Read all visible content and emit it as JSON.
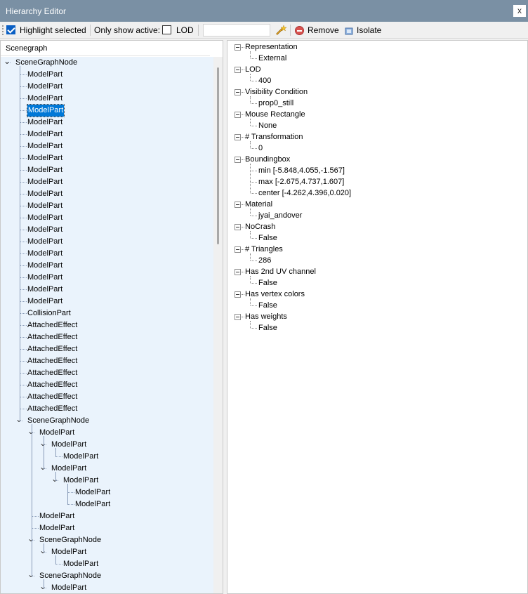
{
  "window": {
    "title": "Hierarchy Editor",
    "close_glyph": "x"
  },
  "toolbar": {
    "highlight_selected": {
      "label": "Highlight selected",
      "checked": true
    },
    "only_show_active_label": "Only show active:",
    "lod": {
      "label": "LOD",
      "checked": false
    },
    "search_value": "",
    "remove_label": "Remove",
    "isolate_label": "Isolate",
    "icons": [
      "wand-icon",
      "remove-icon",
      "isolate-icon"
    ]
  },
  "scenegraph": {
    "header": "Scenegraph",
    "nodes": [
      {
        "label": "SceneGraphNode",
        "depth": 0,
        "expanded": true
      },
      {
        "label": "ModelPart",
        "depth": 1
      },
      {
        "label": "ModelPart",
        "depth": 1
      },
      {
        "label": "ModelPart",
        "depth": 1
      },
      {
        "label": "ModelPart",
        "depth": 1,
        "selected": true
      },
      {
        "label": "ModelPart",
        "depth": 1
      },
      {
        "label": "ModelPart",
        "depth": 1
      },
      {
        "label": "ModelPart",
        "depth": 1
      },
      {
        "label": "ModelPart",
        "depth": 1
      },
      {
        "label": "ModelPart",
        "depth": 1
      },
      {
        "label": "ModelPart",
        "depth": 1
      },
      {
        "label": "ModelPart",
        "depth": 1
      },
      {
        "label": "ModelPart",
        "depth": 1
      },
      {
        "label": "ModelPart",
        "depth": 1
      },
      {
        "label": "ModelPart",
        "depth": 1
      },
      {
        "label": "ModelPart",
        "depth": 1
      },
      {
        "label": "ModelPart",
        "depth": 1
      },
      {
        "label": "ModelPart",
        "depth": 1
      },
      {
        "label": "ModelPart",
        "depth": 1
      },
      {
        "label": "ModelPart",
        "depth": 1
      },
      {
        "label": "ModelPart",
        "depth": 1
      },
      {
        "label": "CollisionPart",
        "depth": 1
      },
      {
        "label": "AttachedEffect",
        "depth": 1
      },
      {
        "label": "AttachedEffect",
        "depth": 1
      },
      {
        "label": "AttachedEffect",
        "depth": 1
      },
      {
        "label": "AttachedEffect",
        "depth": 1
      },
      {
        "label": "AttachedEffect",
        "depth": 1
      },
      {
        "label": "AttachedEffect",
        "depth": 1
      },
      {
        "label": "AttachedEffect",
        "depth": 1
      },
      {
        "label": "AttachedEffect",
        "depth": 1
      },
      {
        "label": "SceneGraphNode",
        "depth": 1,
        "expanded": true
      },
      {
        "label": "ModelPart",
        "depth": 2,
        "expanded": true
      },
      {
        "label": "ModelPart",
        "depth": 3,
        "expanded": true
      },
      {
        "label": "ModelPart",
        "depth": 4
      },
      {
        "label": "ModelPart",
        "depth": 3,
        "expanded": true
      },
      {
        "label": "ModelPart",
        "depth": 4,
        "expanded": true
      },
      {
        "label": "ModelPart",
        "depth": 5
      },
      {
        "label": "ModelPart",
        "depth": 5
      },
      {
        "label": "ModelPart",
        "depth": 2
      },
      {
        "label": "ModelPart",
        "depth": 2
      },
      {
        "label": "SceneGraphNode",
        "depth": 2,
        "expanded": true
      },
      {
        "label": "ModelPart",
        "depth": 3,
        "expanded": true
      },
      {
        "label": "ModelPart",
        "depth": 4
      },
      {
        "label": "SceneGraphNode",
        "depth": 2,
        "expanded": true
      },
      {
        "label": "ModelPart",
        "depth": 3,
        "expanded": true
      }
    ]
  },
  "properties": [
    {
      "name": "Representation",
      "values": [
        "External"
      ]
    },
    {
      "name": "LOD",
      "values": [
        "400"
      ]
    },
    {
      "name": "Visibility Condition",
      "values": [
        "prop0_still"
      ]
    },
    {
      "name": "Mouse Rectangle",
      "values": [
        "None"
      ]
    },
    {
      "name": "# Transformation",
      "values": [
        "0"
      ]
    },
    {
      "name": "Boundingbox",
      "values": [
        "min [-5.848,4.055,-1.567]",
        "max [-2.675,4.737,1.607]",
        "center [-4.262,4.396,0.020]"
      ]
    },
    {
      "name": "Material",
      "values": [
        "jyai_andover"
      ]
    },
    {
      "name": "NoCrash",
      "values": [
        "False"
      ]
    },
    {
      "name": "# Triangles",
      "values": [
        "286"
      ]
    },
    {
      "name": "Has 2nd UV channel",
      "values": [
        "False"
      ]
    },
    {
      "name": "Has vertex colors",
      "values": [
        "False"
      ]
    },
    {
      "name": "Has weights",
      "values": [
        "False"
      ]
    }
  ]
}
